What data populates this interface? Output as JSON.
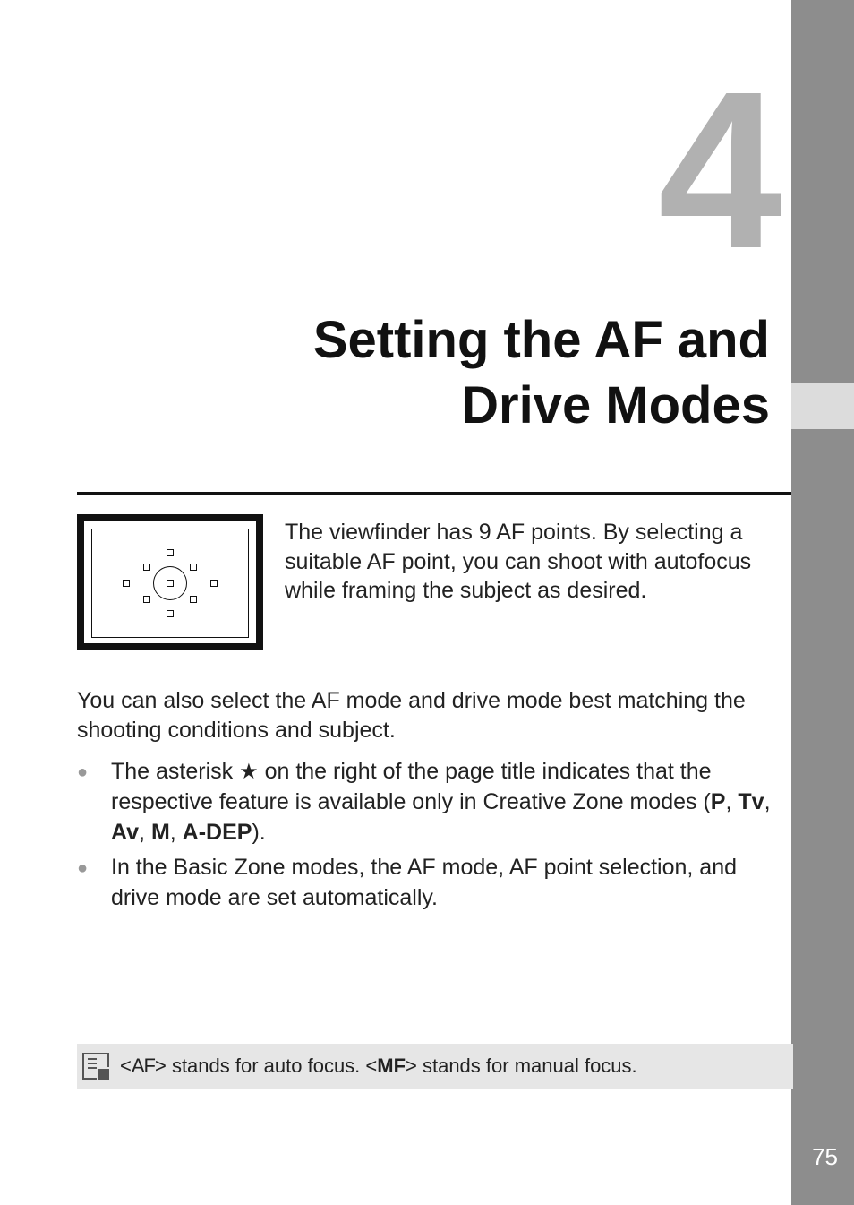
{
  "chapter": {
    "number": "4",
    "title_line1": "Setting the AF and",
    "title_line2": "Drive Modes"
  },
  "intro": "The viewfinder has 9 AF points. By selecting a suitable AF point, you can shoot with autofocus while framing the subject as desired.",
  "body": "You can also select the AF mode and drive mode best matching the shooting conditions and subject.",
  "bullets": [
    {
      "pre": "The asterisk ",
      "star": "★",
      "mid": " on the right of the page title indicates that the respective feature is available only in Creative Zone modes (",
      "modes": [
        "P",
        "Tv",
        "Av",
        "M",
        "A-DEP"
      ],
      "post": ")."
    },
    {
      "text": "In the Basic Zone modes, the AF mode, AF point selection, and drive mode are set automatically."
    }
  ],
  "note": {
    "pre": "<",
    "af": "AF",
    "mid1": "> stands for auto focus. <",
    "mf": "MF",
    "mid2": "> stands for manual focus."
  },
  "page_number": "75",
  "icons": {
    "note": "note-page-icon",
    "star": "star-icon",
    "viewfinder": "viewfinder-af-points-icon"
  }
}
